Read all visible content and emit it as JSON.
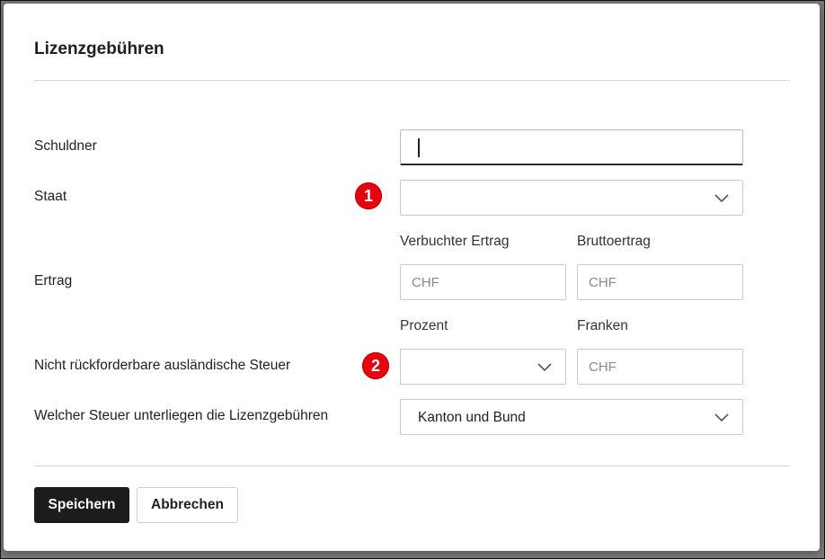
{
  "dialog": {
    "title": "Lizenzgebühren",
    "fields": {
      "schuldner": {
        "label": "Schuldner",
        "value": ""
      },
      "staat": {
        "label": "Staat",
        "value": "",
        "badge": "1"
      },
      "ertrag": {
        "label": "Ertrag",
        "col1_label": "Verbuchter Ertrag",
        "col2_label": "Bruttoertrag",
        "col1_placeholder": "CHF",
        "col2_placeholder": "CHF"
      },
      "steuer": {
        "label": "Nicht rückforderbare ausländische Steuer",
        "col1_label": "Prozent",
        "col2_label": "Franken",
        "col1_value": "",
        "col2_placeholder": "CHF",
        "badge": "2"
      },
      "unterliegen": {
        "label": "Welcher Steuer unterliegen die Lizenzgebühren",
        "value": "Kanton und Bund"
      }
    },
    "buttons": {
      "save": "Speichern",
      "cancel": "Abbrechen"
    }
  }
}
